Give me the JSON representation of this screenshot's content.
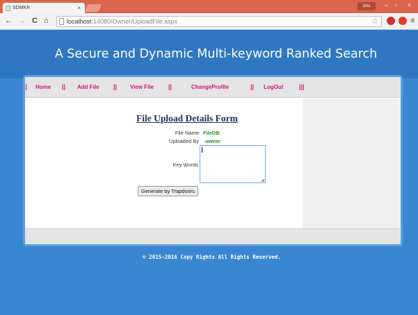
{
  "browser": {
    "tab_title": "SDMKR",
    "tab_close": "×",
    "user_badge": "sinu",
    "url_host": "localhost",
    "url_rest": ":14080/Owner/UploadFile.aspx",
    "minimize": "–",
    "restore": "▫",
    "close": "×",
    "back_icon": "←",
    "forward_icon": "→",
    "reload_icon": "C",
    "home_icon": "⌂",
    "star_icon": "☆",
    "menu_icon": "≡"
  },
  "header": {
    "title": "A Secure and Dynamic Multi-keyword Ranked Search"
  },
  "nav": {
    "separator": "||",
    "last_separator": "|||",
    "items": [
      {
        "label": "Home"
      },
      {
        "label": "Add File"
      },
      {
        "label": "View File"
      },
      {
        "label": "ChangeProfile"
      },
      {
        "label": "LogOut"
      }
    ]
  },
  "form": {
    "title": "File Upload Details Form",
    "file_name_label": "File Name",
    "file_name_value": "FileDB",
    "uploaded_by_label": "Uploaded By",
    "uploaded_by_value": "owner",
    "keywords_label": "Key Words",
    "keywords_value": "",
    "button_label": "Generate by Trapdoors"
  },
  "footer": {
    "copyright": "© 2015-2016 Copy Rights All Rights Reserved."
  },
  "colors": {
    "accent_nav": "#d0157a",
    "page_bg": "#3a86d0",
    "value_green": "#1a9a1a"
  }
}
